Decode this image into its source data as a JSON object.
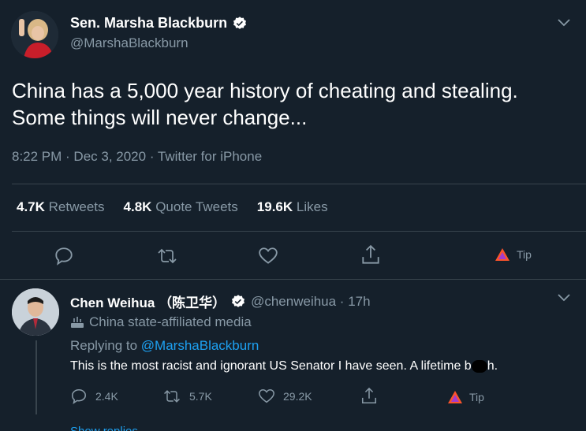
{
  "tweet": {
    "author_name": "Sen. Marsha Blackburn",
    "handle": "@MarshaBlackburn",
    "text_line1": "China has a 5,000 year history of cheating and stealing.",
    "text_line2": "Some things will never change...",
    "meta": "8:22 PM · Dec 3, 2020 · Twitter for iPhone",
    "retweets_count": "4.7K",
    "retweets_label": "Retweets",
    "quotes_count": "4.8K",
    "quotes_label": "Quote Tweets",
    "likes_count": "19.6K",
    "likes_label": "Likes",
    "tip_label": "Tip"
  },
  "reply": {
    "author_name": "Chen Weihua （陈卫华）",
    "handle_time": "@chenweihua · 17h",
    "label": "China state-affiliated media",
    "replying_prefix": "Replying to",
    "replying_to": "@MarshaBlackburn",
    "text_before": "This is the most racist and ignorant US Senator I have seen.  A lifetime b",
    "text_after": "h.",
    "reply_count": "2.4K",
    "retweet_count": "5.7K",
    "like_count": "29.2K",
    "tip_label": "Tip",
    "next_link": "Show replies"
  },
  "colors": {
    "background": "#15202b",
    "muted": "#8899a6",
    "accent": "#1da1f2",
    "divider": "#38444d"
  },
  "icons": [
    "verified-badge-icon",
    "chevron-down-icon",
    "reply-icon",
    "retweet-icon",
    "like-icon",
    "share-icon",
    "tip-icon",
    "state-media-icon"
  ]
}
